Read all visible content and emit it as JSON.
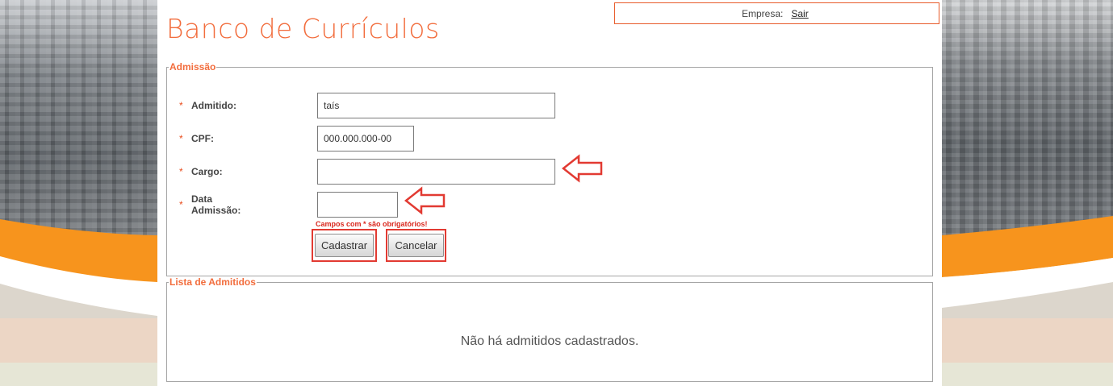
{
  "header": {
    "title": "Banco de Currículos",
    "company_label": "Empresa:",
    "logout_label": "Sair"
  },
  "admission": {
    "legend": "Admissão",
    "required_marker": "*",
    "fields": {
      "admitted": {
        "label": "Admitido:",
        "value": "taís"
      },
      "cpf": {
        "label": "CPF:",
        "value": "000.000.000-00"
      },
      "role": {
        "label": "Cargo:",
        "value": ""
      },
      "admission_date": {
        "label": "Data Admissão:",
        "value": ""
      }
    },
    "required_note": "Campos com * são obrigatórios!",
    "buttons": {
      "submit": "Cadastrar",
      "cancel": "Cancelar"
    }
  },
  "list": {
    "legend": "Lista de Admitidos",
    "empty_message": "Não há admitidos cadastrados."
  },
  "colors": {
    "accent": "#f26d3d",
    "highlight": "#e23a32",
    "required": "#e84c1c"
  }
}
